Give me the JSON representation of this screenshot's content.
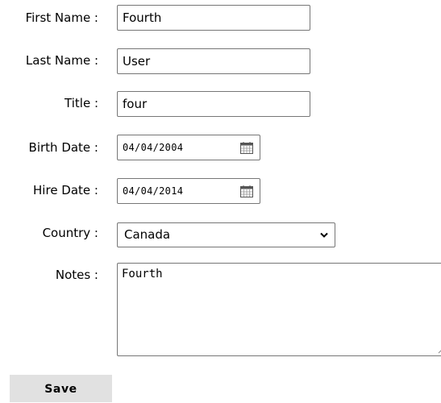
{
  "form": {
    "fields": {
      "first_name": {
        "label": "First Name :",
        "value": "Fourth"
      },
      "last_name": {
        "label": "Last Name :",
        "value": "User"
      },
      "title": {
        "label": "Title :",
        "value": "four"
      },
      "birth_date": {
        "label": "Birth Date :",
        "value": "04/04/2004",
        "icon": "calendar-icon"
      },
      "hire_date": {
        "label": "Hire Date :",
        "value": "04/04/2014",
        "icon": "calendar-icon"
      },
      "country": {
        "label": "Country :",
        "value": "Canada",
        "icon": "chevron-down-icon"
      },
      "notes": {
        "label": "Notes :",
        "value": "Fourth"
      }
    },
    "save_label": "Save"
  },
  "colors": {
    "input_border": "#767676",
    "button_background": "#e1e1e1",
    "text": "#000000"
  }
}
